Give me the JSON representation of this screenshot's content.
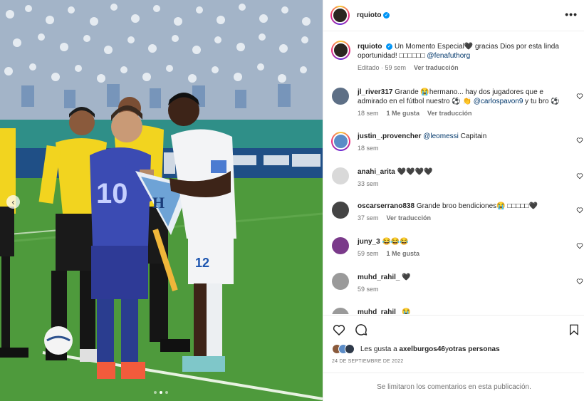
{
  "post": {
    "author": "rquioto",
    "more_glyph": "•••",
    "carousel_prev_glyph": "‹",
    "carousel_dots": 3,
    "carousel_active": 2
  },
  "caption": {
    "username": "rquioto",
    "text_1": "Un Momento Especial",
    "heart": "🖤",
    "text_2": " gracias Dios por esta linda oportunidad! ",
    "emoji_run": "□□□□□□",
    "mention": "@fenafuthorg",
    "age": "Editado · 59 sem",
    "translate": "Ver traducción"
  },
  "comments": [
    {
      "username": "jl_river317",
      "text_pre": "Grande 😭hermano... hay dos jugadores que e admirado en el fútbol nuestro ⚽ 👏 ",
      "mention": "@carlospavon9",
      "text_post": " y tu bro ⚽",
      "age": "18 sem",
      "likes": "1 Me gusta",
      "translate": "Ver traducción"
    },
    {
      "username": "justin_.provencher",
      "mention": "@leomessi",
      "text_post": " Capitain",
      "age": "18 sem"
    },
    {
      "username": "anahi_arita",
      "text_pre": "🖤🖤🖤🖤",
      "age": "33 sem"
    },
    {
      "username": "oscarserrano838",
      "text_pre": "Grande broo bendiciones😭 □□□□□🖤",
      "age": "37 sem",
      "translate": "Ver traducción"
    },
    {
      "username": "juny_3",
      "text_pre": "😂😂😂",
      "age": "59 sem",
      "likes": "1 Me gusta"
    },
    {
      "username": "muhd_rahil_",
      "text_pre": "🖤",
      "age": "59 sem"
    },
    {
      "username": "muhd_rahil_",
      "text_pre": "😭"
    }
  ],
  "likes": {
    "prefix": "Les gusta a ",
    "user": "axelburgos46",
    "mid": " y ",
    "others": "otras personas"
  },
  "date": "24 DE SEPTIEMBRE DE 2022",
  "comments_disabled": "Se limitaron los comentarios en esta publicación.",
  "colors": {
    "link": "#00376b",
    "verified": "#0095f6",
    "muted": "#737373",
    "pitch": "#4e9a3c",
    "argentina_kit": "#3b4bb3",
    "referee_kit": "#f2d41f"
  }
}
